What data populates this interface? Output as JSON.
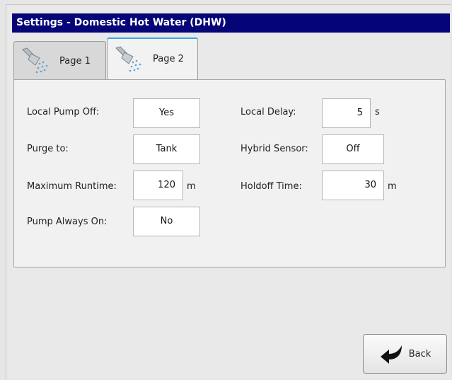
{
  "window": {
    "title": "Settings - Domestic Hot Water (DHW)"
  },
  "tabs": [
    {
      "label": "Page 1",
      "icon": "shower-head-icon",
      "active": false
    },
    {
      "label": "Page 2",
      "icon": "shower-head-icon",
      "active": true
    }
  ],
  "settings": {
    "local_pump_off": {
      "label": "Local Pump Off:",
      "value": "Yes"
    },
    "purge_to": {
      "label": "Purge to:",
      "value": "Tank"
    },
    "maximum_runtime": {
      "label": "Maximum Runtime:",
      "value": "120",
      "unit": "m"
    },
    "pump_always_on": {
      "label": "Pump Always On:",
      "value": "No"
    },
    "local_delay": {
      "label": "Local Delay:",
      "value": "5",
      "unit": "s"
    },
    "hybrid_sensor": {
      "label": "Hybrid Sensor:",
      "value": "Off"
    },
    "holdoff_time": {
      "label": "Holdoff Time:",
      "value": "30",
      "unit": "m"
    }
  },
  "back_button": {
    "label": "Back",
    "icon": "back-arrow-icon"
  },
  "colors": {
    "titlebar": "#050578",
    "active_tab_accent": "#3aa6e8"
  }
}
